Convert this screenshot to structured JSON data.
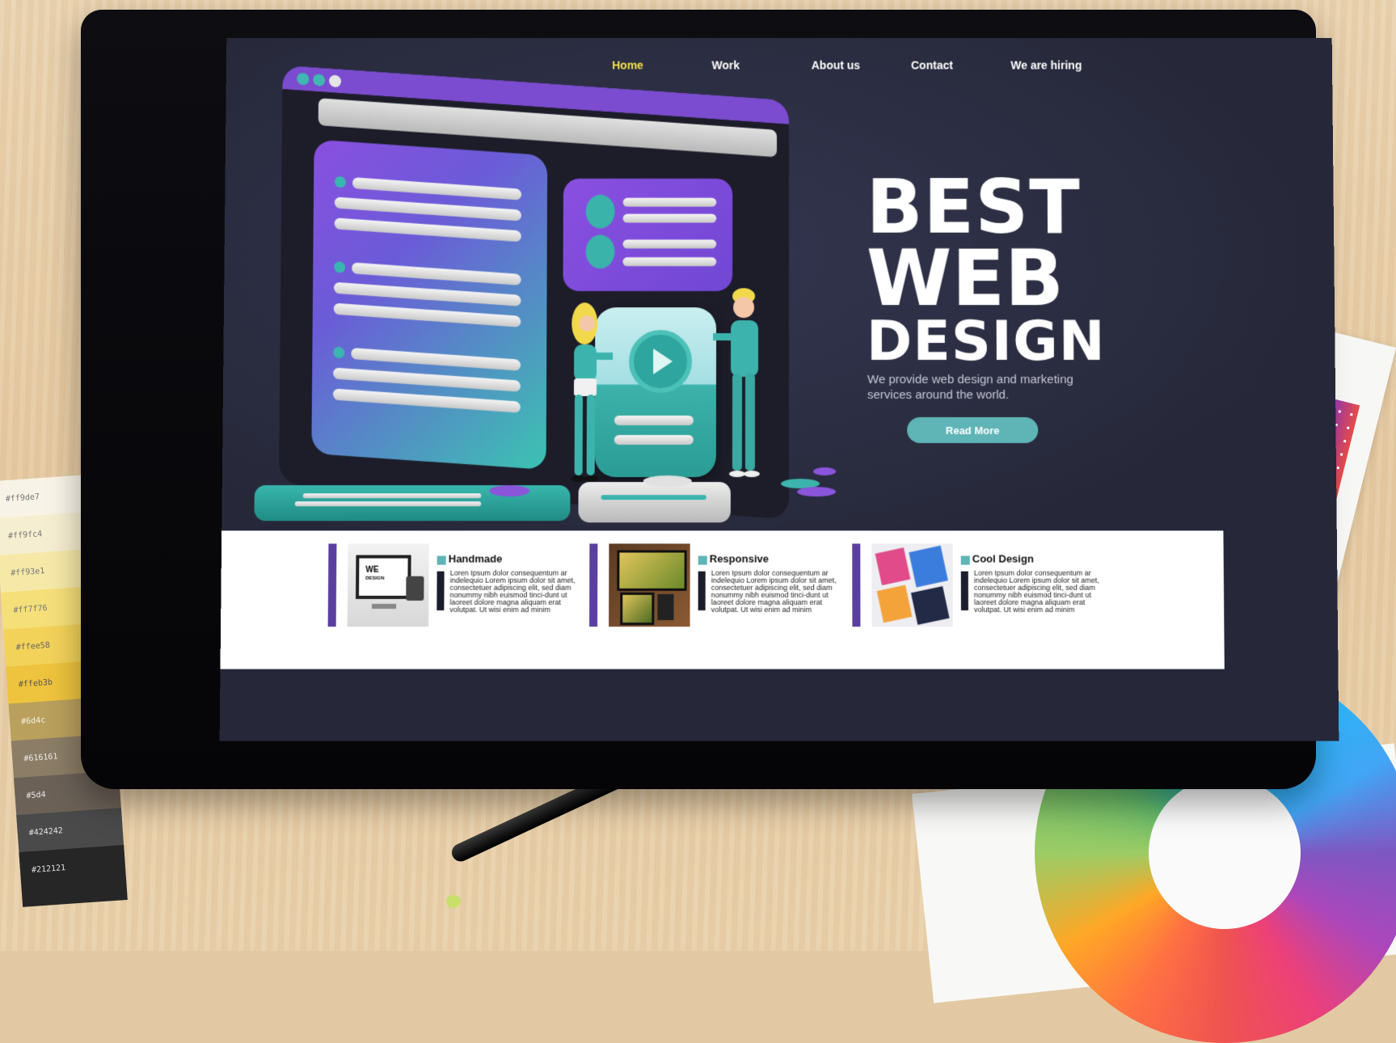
{
  "nav": {
    "items": [
      {
        "label": "Home",
        "active": true
      },
      {
        "label": "Work",
        "active": false
      },
      {
        "label": "About us",
        "active": false
      },
      {
        "label": "Contact",
        "active": false
      },
      {
        "label": "We are hiring",
        "active": false
      }
    ]
  },
  "hero": {
    "headline": [
      "BEST",
      "WEB",
      "DESIGN"
    ],
    "subtitle": "We provide  web design and marketing services around the world.",
    "cta_label": "Read More"
  },
  "features": [
    {
      "title": "Handmade",
      "text": "Loren Ipsum dolor consequentum ar indelequio Lorem ipsum dolor sit amet, consectetuer adipiscing elit, sed diam nonummy nibh euismod tinci-dunt ut laoreet dolore magna aliquam erat volutpat. Ut wisi enim ad minim"
    },
    {
      "title": "Responsive",
      "text": "Loren Ipsum dolor consequentum ar indelequio Lorem ipsum dolor sit amet, consectetuer adipiscing elit, sed diam nonummy nibh euismod tinci-dunt ut laoreet dolore magna aliquam erat volutpat. Ut wisi enim ad minim"
    },
    {
      "title": "Cool Design",
      "text": "Loren Ipsum dolor consequentum ar indelequio Lorem ipsum dolor sit amet, consectetuer adipiscing elit, sed diam nonummy nibh euismod tinci-dunt ut laoreet dolore magna aliquam erat volutpat. Ut wisi enim ad minim"
    }
  ],
  "thumb_headline": [
    "WE",
    "DESIGN"
  ],
  "swatches": [
    "#ff9de7",
    "#ff9fc4",
    "#ff93e1",
    "#ff7f76",
    "#ffee58",
    "#ffeb3b",
    "#6d4c",
    "#616161",
    "#5d4",
    "#424242",
    "#212121"
  ],
  "colors": {
    "nav_active": "#f2e14a",
    "hero_bg": "#262839",
    "accent_teal": "#5fb4b6",
    "accent_purple": "#5b3fa0",
    "device_frame": "#0d0d12"
  },
  "icons": [
    "play-icon"
  ]
}
